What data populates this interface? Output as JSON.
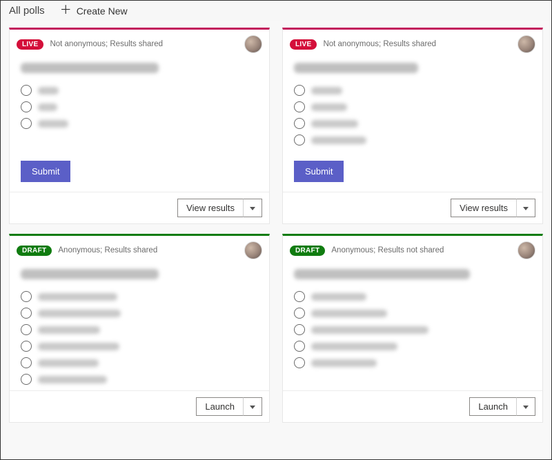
{
  "toolbar": {
    "title": "All polls",
    "create_label": "Create New"
  },
  "badges": {
    "live": "LIVE",
    "draft": "DRAFT"
  },
  "buttons": {
    "submit": "Submit",
    "view_results": "View results",
    "launch": "Launch"
  },
  "cards": [
    {
      "status": "live",
      "meta": "Not anonymous; Results shared",
      "question_w": 200,
      "options_w": [
        30,
        28,
        44
      ],
      "action": "view_results",
      "show_submit": true
    },
    {
      "status": "live",
      "meta": "Not anonymous; Results shared",
      "question_w": 180,
      "options_w": [
        45,
        52,
        68,
        80
      ],
      "action": "view_results",
      "show_submit": true
    },
    {
      "status": "draft",
      "meta": "Anonymous; Results shared",
      "question_w": 200,
      "options_w": [
        115,
        120,
        90,
        118,
        88,
        100
      ],
      "action": "launch",
      "show_submit": false
    },
    {
      "status": "draft",
      "meta": "Anonymous; Results not shared",
      "question_w": 255,
      "options_w": [
        80,
        110,
        170,
        125,
        95
      ],
      "action": "launch",
      "show_submit": false
    }
  ]
}
